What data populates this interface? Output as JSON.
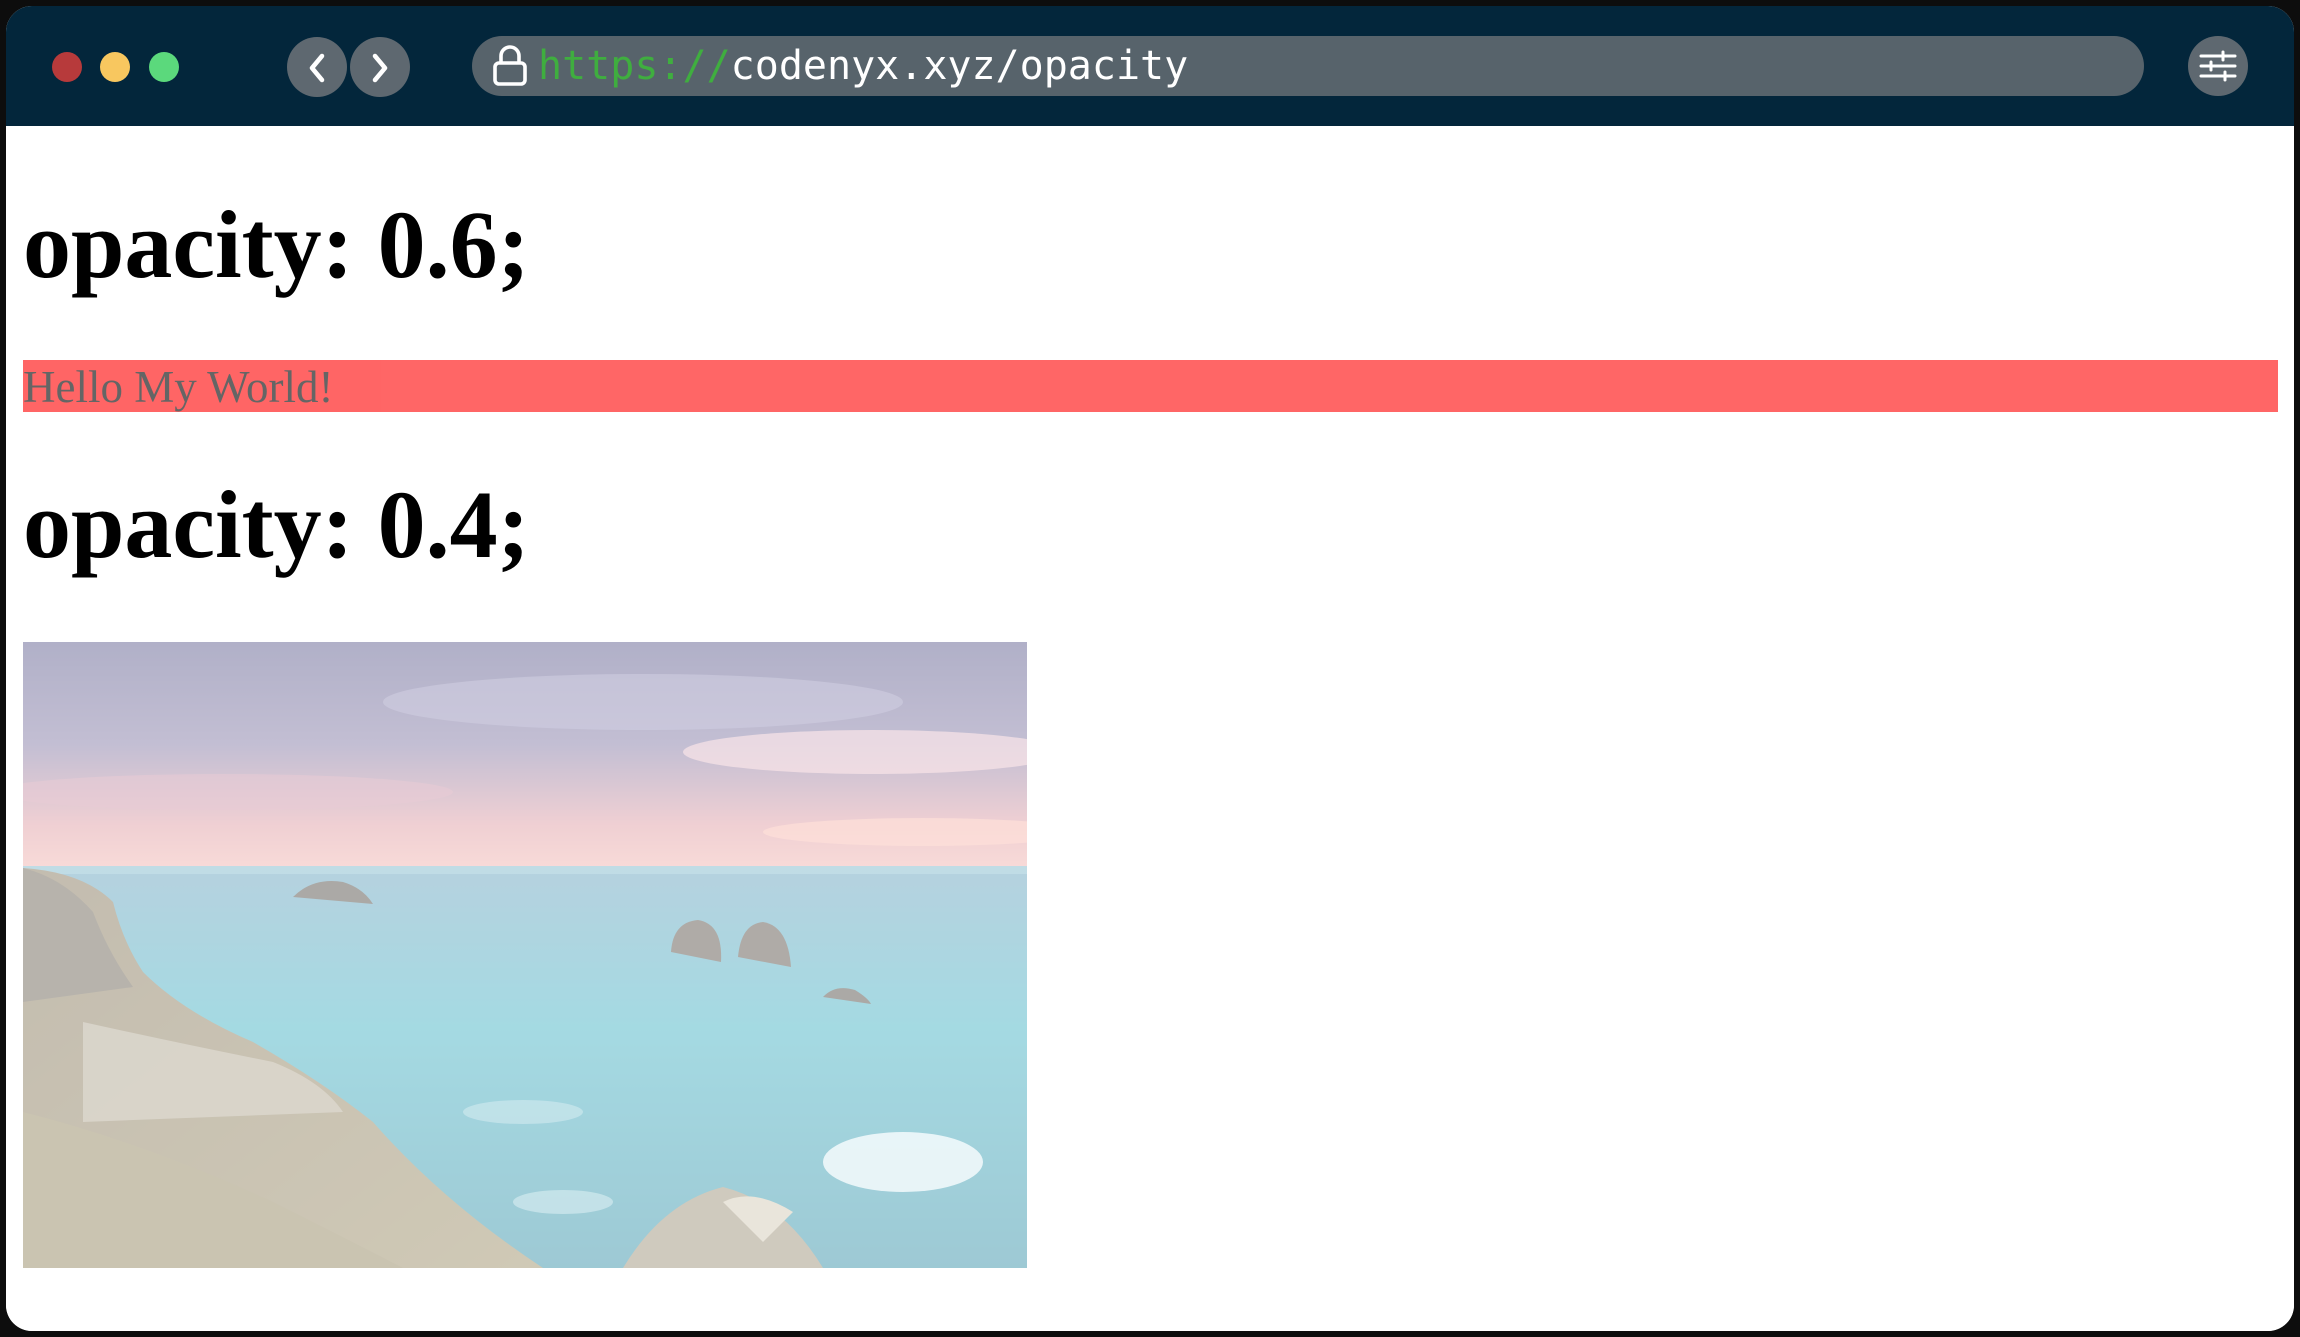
{
  "browser": {
    "url_scheme": "https://",
    "url_rest": "codenyx.xyz/opacity",
    "icons": {
      "back": "chevron-left-icon",
      "forward": "chevron-right-icon",
      "lock": "lock-icon",
      "settings": "sliders-icon"
    },
    "traffic_light_colors": [
      "#b73a3b",
      "#f8c75f",
      "#5bd97c"
    ],
    "titlebar_color": "#03263b"
  },
  "page": {
    "heading_1": "opacity: 0.6;",
    "banner_text": "Hello My World!",
    "banner_color": "#ff0000",
    "banner_opacity": 0.6,
    "heading_2": "opacity: 0.4;",
    "image_opacity": 0.4,
    "image_subject": "coastal seascape with rock stacks"
  }
}
